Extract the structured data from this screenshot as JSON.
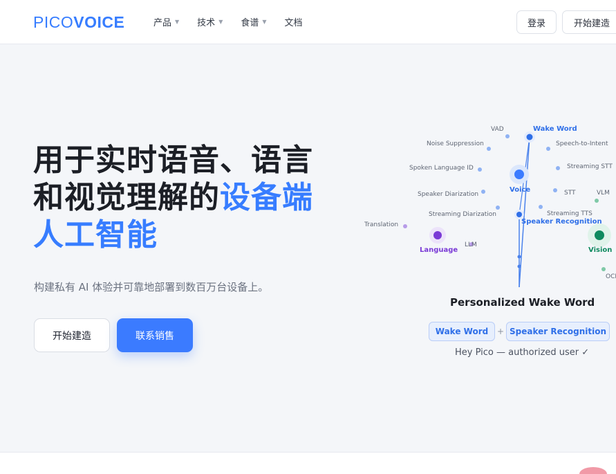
{
  "header": {
    "logo_prefix": "PICO",
    "logo_suffix": "VOICE",
    "nav": [
      {
        "label": "产品",
        "has_caret": true
      },
      {
        "label": "技术",
        "has_caret": true
      },
      {
        "label": "食谱",
        "has_caret": true
      },
      {
        "label": "文档",
        "has_caret": false
      }
    ],
    "login_label": "登录",
    "start_label": "开始建造"
  },
  "hero": {
    "title_line1": "用于实时语音、语言",
    "title_line2_a": "和视觉理解的",
    "title_line2_b": "设备端",
    "title_line3": "人工智能",
    "subtitle": "构建私有 AI 体验并可靠地部署到数百万台设备上。",
    "btn_build": "开始建造",
    "btn_sales": "联系销售"
  },
  "diagram": {
    "labels": {
      "vad": "VAD",
      "wake_word": "Wake Word",
      "noise_suppression": "Noise Suppression",
      "speech_to_intent": "Speech-to-Intent",
      "spoken_language_id": "Spoken Language ID",
      "streaming_stt": "Streaming STT",
      "voice": "Voice",
      "speaker_diarization": "Speaker Diarization",
      "stt": "STT",
      "vlm": "VLM",
      "streaming_diarization": "Streaming Diarization",
      "streaming_tts": "Streaming TTS",
      "speaker_recognition": "Speaker Recognition",
      "translation": "Translation",
      "language": "Language",
      "llm": "LLM",
      "vision": "Vision",
      "ocr": "OCR"
    },
    "panel_title": "Personalized Wake Word",
    "chip_wake_word": "Wake Word",
    "chip_plus": "+",
    "chip_speaker": "Speaker Recognition",
    "caption": "Hey Pico — authorized user ✓"
  },
  "colors": {
    "accent": "#377dff",
    "voice_blue": "#2f6fe8",
    "language_purple": "#7a3ad6",
    "vision_green": "#0f8a5f"
  }
}
